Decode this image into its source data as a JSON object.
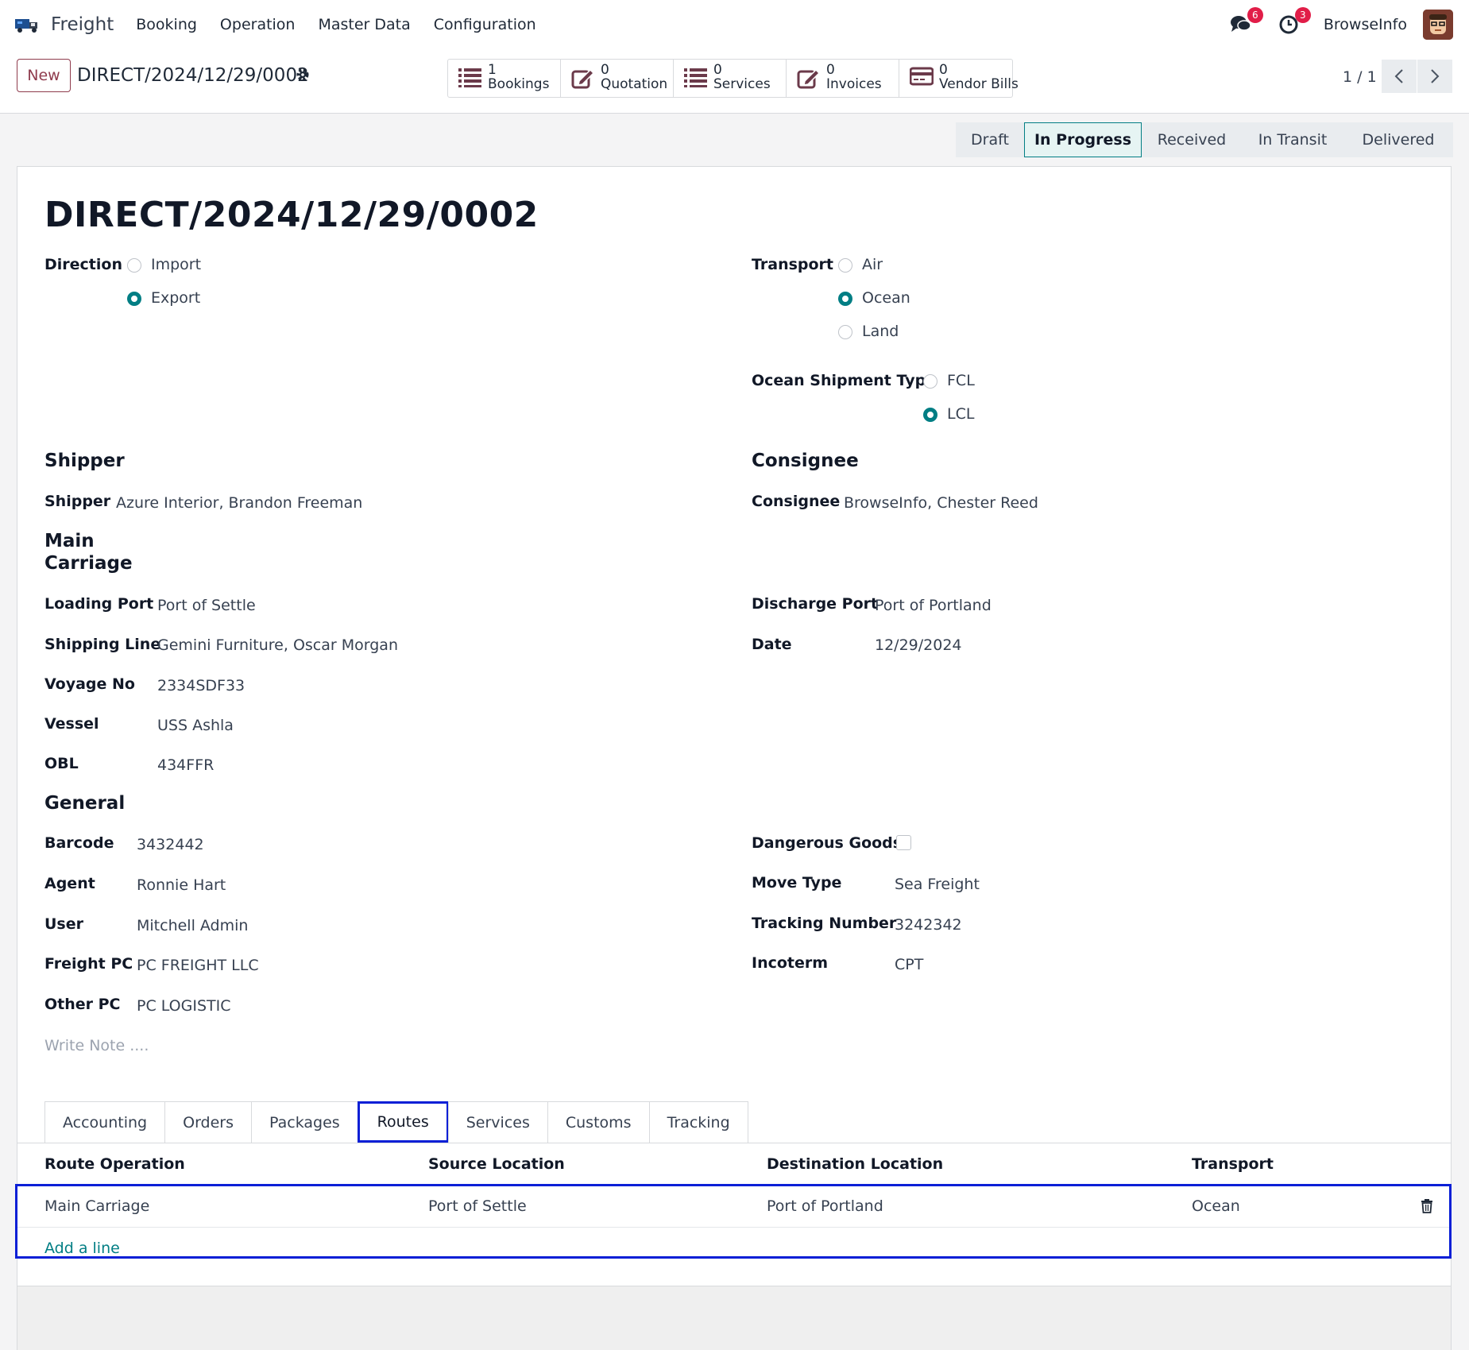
{
  "nav": {
    "app_name": "Freight",
    "menu": [
      "Booking",
      "Operation",
      "Master Data",
      "Configuration"
    ],
    "messages_count": "6",
    "activities_count": "3",
    "company": "BrowseInfo"
  },
  "control": {
    "new_label": "New",
    "breadcrumb": "DIRECT/2024/12/29/0002",
    "smart_buttons": [
      {
        "count": "1",
        "label": "Bookings",
        "icon": "list-icon"
      },
      {
        "count": "0",
        "label": "Quotation",
        "icon": "edit-icon"
      },
      {
        "count": "0",
        "label": "Services",
        "icon": "list-icon"
      },
      {
        "count": "0",
        "label": "Invoices",
        "icon": "edit-icon"
      },
      {
        "count": "0",
        "label": "Vendor Bills",
        "icon": "credit-card-icon"
      }
    ],
    "pager": "1 / 1"
  },
  "statusbar": {
    "stages": [
      "Draft",
      "In Progress",
      "Received",
      "In Transit",
      "Delivered"
    ],
    "active": "In Progress"
  },
  "form": {
    "title": "DIRECT/2024/12/29/0002",
    "direction": {
      "label": "Direction",
      "options": [
        "Import",
        "Export"
      ],
      "selected": "Export"
    },
    "transport": {
      "label": "Transport",
      "options": [
        "Air",
        "Ocean",
        "Land"
      ],
      "selected": "Ocean"
    },
    "ocean_type": {
      "label": "Ocean Shipment Type",
      "options": [
        "FCL",
        "LCL"
      ],
      "selected": "LCL"
    },
    "shipper_section": "Shipper",
    "shipper_label": "Shipper",
    "shipper_value": "Azure Interior, Brandon Freeman",
    "consignee_section": "Consignee",
    "consignee_label": "Consignee",
    "consignee_value": "BrowseInfo, Chester Reed",
    "main_carriage_line1": "Main",
    "main_carriage_line2": "Carriage",
    "loading_port_label": "Loading Port",
    "loading_port_value": "Port of Settle",
    "shipping_line_label": "Shipping Line",
    "shipping_line_value": "Gemini Furniture, Oscar Morgan",
    "voyage_label": "Voyage No",
    "voyage_value": "2334SDF33",
    "vessel_label": "Vessel",
    "vessel_value": "USS Ashla",
    "obl_label": "OBL",
    "obl_value": "434FFR",
    "discharge_port_label": "Discharge Port",
    "discharge_port_value": "Port of Portland",
    "date_label": "Date",
    "date_value": "12/29/2024",
    "general_section": "General",
    "barcode_label": "Barcode",
    "barcode_value": "3432442",
    "agent_label": "Agent",
    "agent_value": "Ronnie Hart",
    "user_label": "User",
    "user_value": "Mitchell Admin",
    "freight_pc_label": "Freight PC",
    "freight_pc_value": "PC FREIGHT LLC",
    "other_pc_label": "Other PC",
    "other_pc_value": "PC LOGISTIC",
    "dangerous_label": "Dangerous Goods",
    "dangerous_checked": false,
    "move_type_label": "Move Type",
    "move_type_value": "Sea Freight",
    "tracking_label": "Tracking Number",
    "tracking_value": "3242342",
    "incoterm_label": "Incoterm",
    "incoterm_value": "CPT",
    "note_placeholder": "Write Note ...."
  },
  "tabs": {
    "items": [
      "Accounting",
      "Orders",
      "Packages",
      "Routes",
      "Services",
      "Customs",
      "Tracking"
    ],
    "active": "Routes"
  },
  "routes_table": {
    "columns": [
      "Route Operation",
      "Source Location",
      "Destination Location",
      "Transport"
    ],
    "rows": [
      {
        "operation": "Main Carriage",
        "source": "Port of Settle",
        "destination": "Port of Portland",
        "transport": "Ocean"
      }
    ],
    "add_line": "Add a line"
  },
  "colors": {
    "brand": "#8f3b4d",
    "accent": "#017e84",
    "highlight": "#0a1fd6",
    "badge": "#e11d48"
  }
}
